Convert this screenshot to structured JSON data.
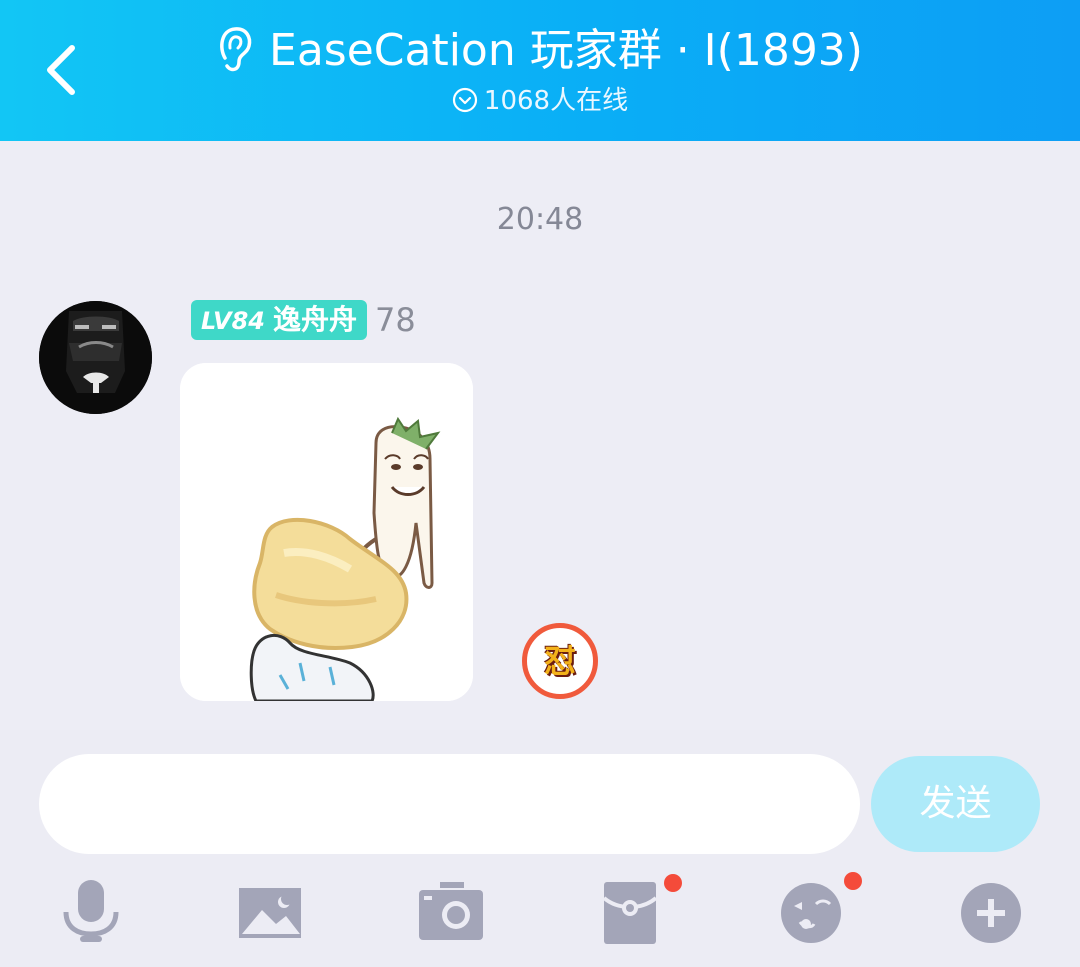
{
  "header": {
    "title": "EaseCation 玩家群 · I(1893)",
    "online": "1068人在线"
  },
  "chat": {
    "timestamp": "20:48",
    "messages": [
      {
        "sender": {
          "level": "LV84",
          "name": "逸舟舟",
          "extra": "78"
        },
        "content_type": "sticker",
        "reaction": "怼"
      }
    ]
  },
  "input": {
    "value": "",
    "placeholder": "",
    "send_label": "发送"
  },
  "toolbar": {
    "items": [
      {
        "icon": "microphone-icon",
        "badge": false
      },
      {
        "icon": "image-icon",
        "badge": false
      },
      {
        "icon": "camera-icon",
        "badge": false
      },
      {
        "icon": "red-packet-icon",
        "badge": true
      },
      {
        "icon": "emoji-icon",
        "badge": true
      },
      {
        "icon": "plus-icon",
        "badge": false
      }
    ]
  },
  "colors": {
    "header_start": "#12c6f5",
    "header_end": "#0d9ef5",
    "level_badge": "#3fd8c8",
    "send_button": "#aeeaf9",
    "notification_dot": "#f44b3a",
    "icon_gray": "#a3a5b8"
  }
}
